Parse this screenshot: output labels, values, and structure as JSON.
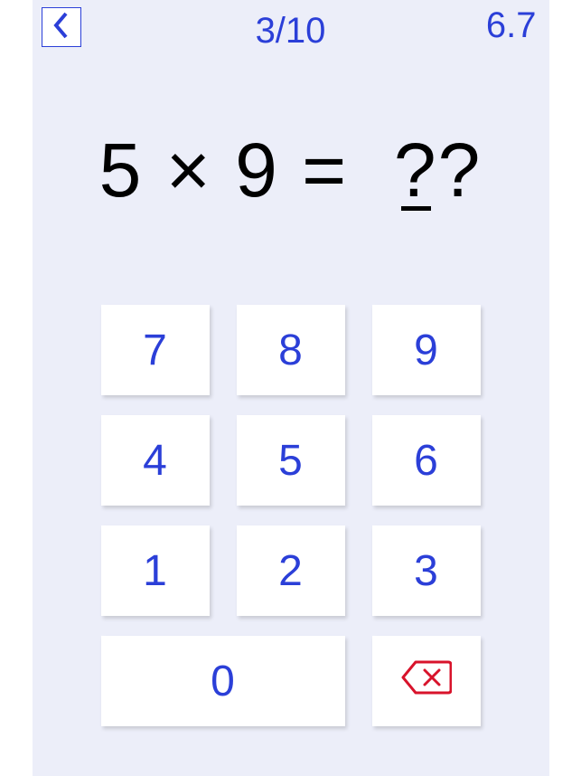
{
  "header": {
    "progress": "3/10",
    "timer": "6.7"
  },
  "question": {
    "operand1": "5",
    "operator": "×",
    "operand2": "9",
    "equals": "=",
    "placeholder1": "?",
    "placeholder2": "?"
  },
  "keypad": {
    "k7": "7",
    "k8": "8",
    "k9": "9",
    "k4": "4",
    "k5": "5",
    "k6": "6",
    "k1": "1",
    "k2": "2",
    "k3": "3",
    "k0": "0"
  },
  "icons": {
    "back": "chevron-left-icon",
    "delete": "backspace-icon"
  },
  "colors": {
    "accent": "#2b3fd8",
    "danger": "#d8132b",
    "background": "#eceef9"
  }
}
